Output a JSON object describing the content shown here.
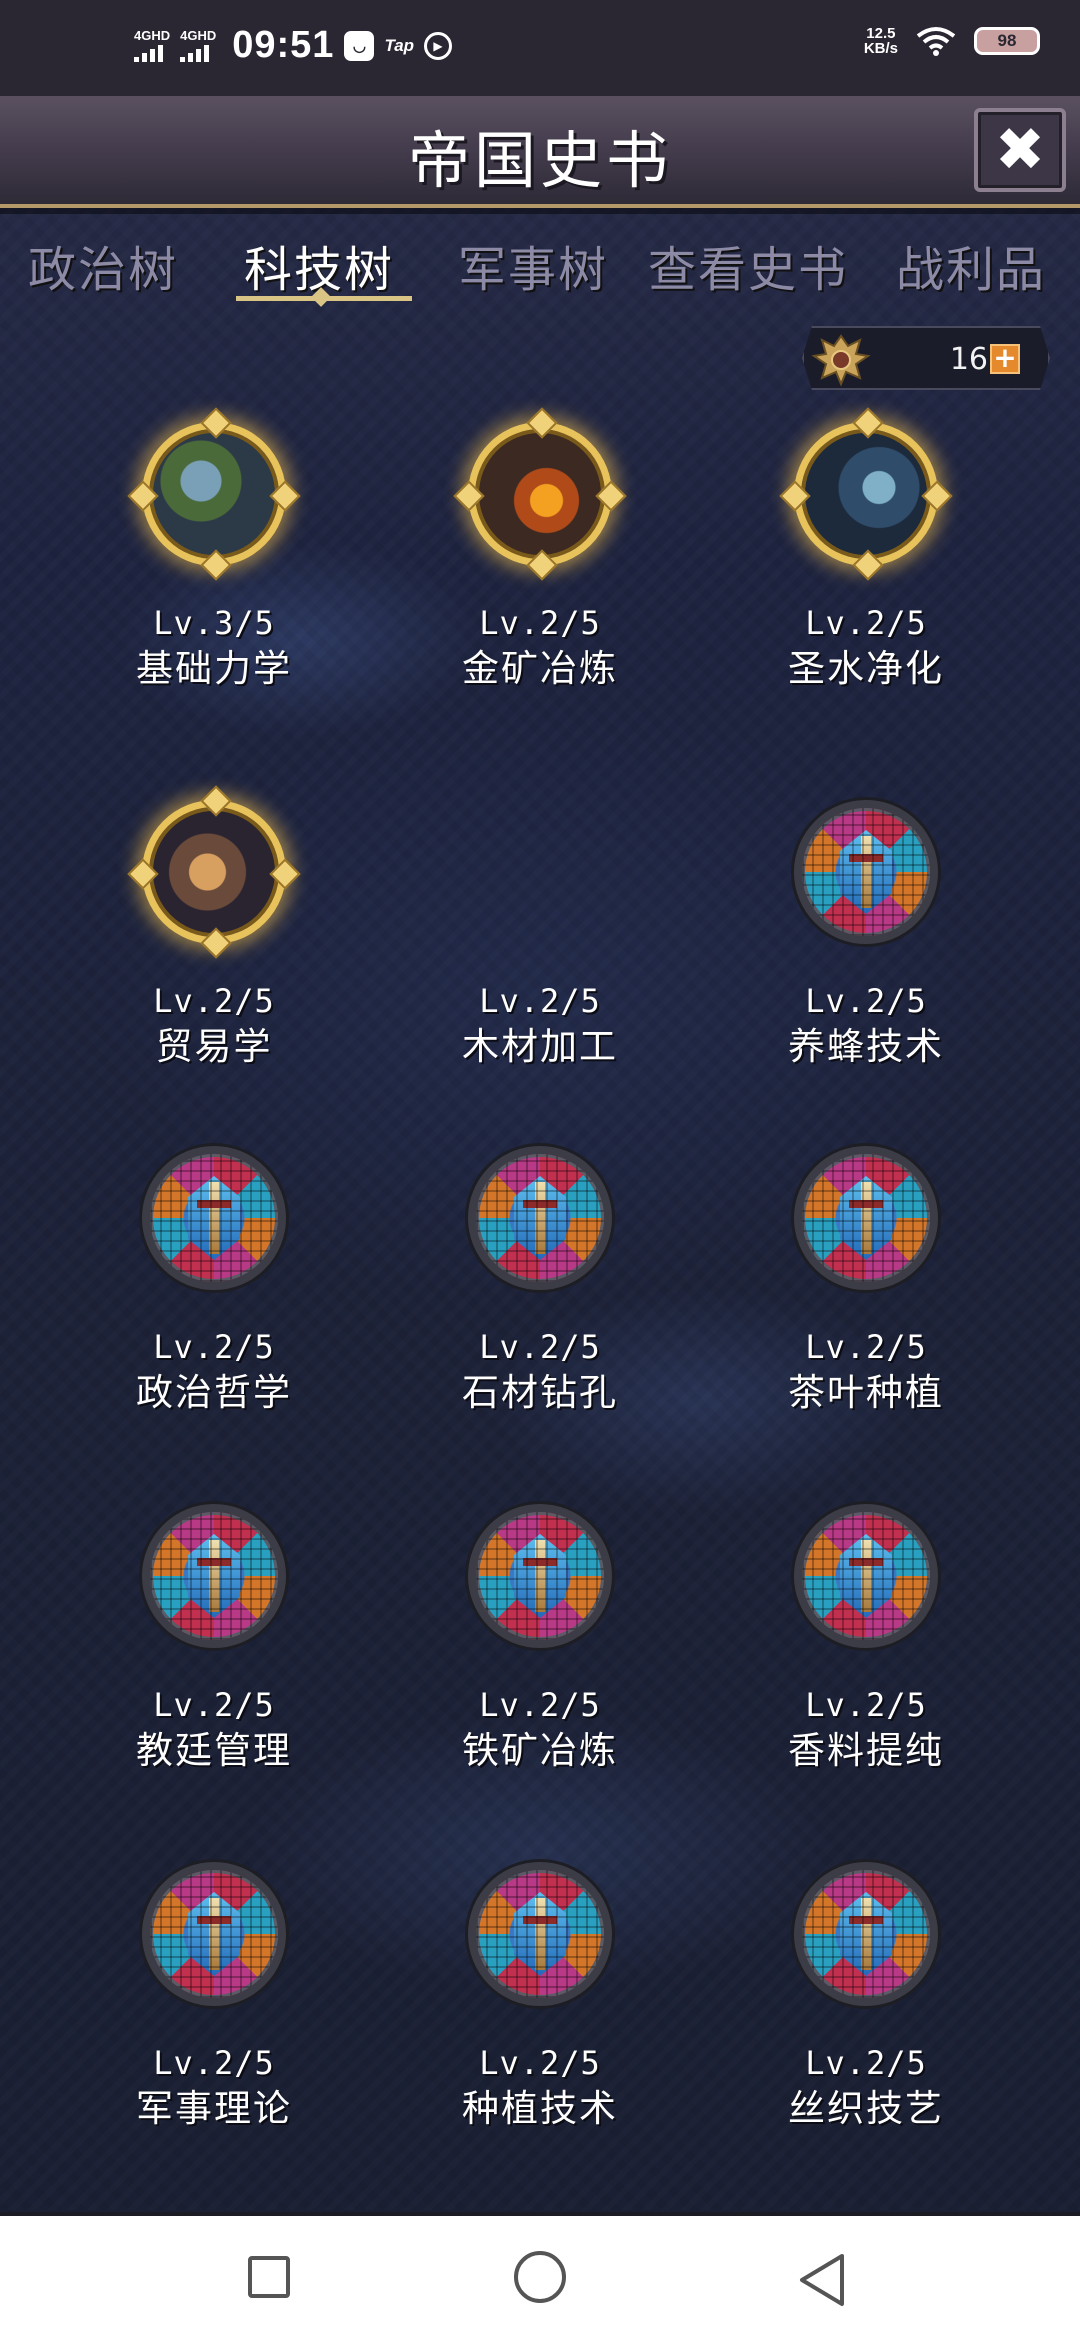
{
  "status_bar": {
    "signal1": "4GHD",
    "signal2": "4GHD",
    "time": "09:51",
    "app_icon_1": "message-app-icon",
    "app_icon_2_label": "Tap",
    "app_icon_3": "play-circle-icon",
    "net_speed_value": "12.5",
    "net_speed_unit": "KB/s",
    "battery": "98"
  },
  "header": {
    "title": "帝国史书",
    "close_icon": "close-icon"
  },
  "tabs": [
    {
      "label": "政治树",
      "active": false
    },
    {
      "label": "科技树",
      "active": true
    },
    {
      "label": "军事树",
      "active": false
    },
    {
      "label": "查看史书",
      "active": false
    },
    {
      "label": "战利品",
      "active": false
    }
  ],
  "currency": {
    "icon": "eagle-emblem-icon",
    "amount": "16",
    "add_icon": "plus-icon"
  },
  "techs": [
    {
      "level": "Lv.3/5",
      "name": "基础力学",
      "state": "unlocked",
      "art": "statue-art"
    },
    {
      "level": "Lv.2/5",
      "name": "金矿冶炼",
      "state": "unlocked",
      "art": "forge-art"
    },
    {
      "level": "Lv.2/5",
      "name": "圣水净化",
      "state": "unlocked",
      "art": "shrine-art"
    },
    {
      "level": "Lv.2/5",
      "name": "贸易学",
      "state": "unlocked",
      "art": "market-art"
    },
    {
      "level": "Lv.2/5",
      "name": "木材加工",
      "state": "empty",
      "art": ""
    },
    {
      "level": "Lv.2/5",
      "name": "养蜂技术",
      "state": "locked",
      "art": "stained-glass-sword"
    },
    {
      "level": "Lv.2/5",
      "name": "政治哲学",
      "state": "locked",
      "art": "stained-glass-sword"
    },
    {
      "level": "Lv.2/5",
      "name": "石材钻孔",
      "state": "locked",
      "art": "stained-glass-sword"
    },
    {
      "level": "Lv.2/5",
      "name": "茶叶种植",
      "state": "locked",
      "art": "stained-glass-sword"
    },
    {
      "level": "Lv.2/5",
      "name": "教廷管理",
      "state": "locked",
      "art": "stained-glass-sword"
    },
    {
      "level": "Lv.2/5",
      "name": "铁矿冶炼",
      "state": "locked",
      "art": "stained-glass-sword"
    },
    {
      "level": "Lv.2/5",
      "name": "香料提纯",
      "state": "locked",
      "art": "stained-glass-sword"
    },
    {
      "level": "Lv.2/5",
      "name": "军事理论",
      "state": "locked",
      "art": "stained-glass-sword"
    },
    {
      "level": "Lv.2/5",
      "name": "种植技术",
      "state": "locked",
      "art": "stained-glass-sword"
    },
    {
      "level": "Lv.2/5",
      "name": "丝织技艺",
      "state": "locked",
      "art": "stained-glass-sword"
    }
  ],
  "nav_bar": {
    "recents": "square-icon",
    "home": "circle-icon",
    "back": "triangle-back-icon"
  },
  "colors": {
    "accent_gold": "#e8c35c",
    "tab_inactive": "#8d8aa6",
    "plus_orange": "#e58a2c"
  }
}
